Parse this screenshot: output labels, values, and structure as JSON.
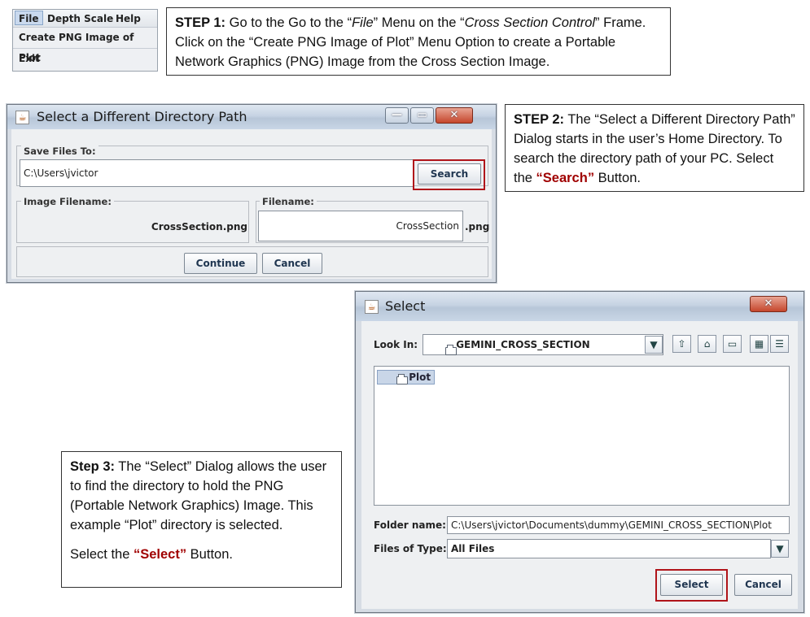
{
  "step1": {
    "menubar": [
      "File",
      "Depth Scale",
      "Help"
    ],
    "menu_items": [
      "Create PNG Image of Plot",
      "Exit"
    ],
    "callout_label": "STEP 1:",
    "callout_pre": " Go to the Go to the “",
    "callout_file": "File",
    "callout_mid": "” Menu on the “",
    "callout_frame": "Cross Section Control",
    "callout_post": "” Frame.  Click on the “Create PNG Image of Plot” Menu Option to create a Portable Network Graphics (PNG) Image from the Cross Section Image."
  },
  "dir_dialog": {
    "title": "Select a Different Directory Path",
    "save_label": "Save Files To:",
    "path_value": "C:\\Users\\jvictor",
    "search_button": "Search",
    "image_filename_label": "Image Filename:",
    "image_filename_value": "CrossSection.png",
    "filename_label": "Filename:",
    "filename_value": "CrossSection",
    "extension": ".png",
    "continue_button": "Continue",
    "cancel_button": "Cancel"
  },
  "step2": {
    "label": "STEP 2:",
    "text_pre": " The “Select a Different Directory Path” Dialog starts in the user’s Home Directory. To search the directory path of your PC. Select the ",
    "highlight": "“Search”",
    "text_post": "  Button."
  },
  "select_dialog": {
    "title": "Select",
    "look_in_label": "Look In:",
    "look_in_value": "GEMINI_CROSS_SECTION",
    "list_items": [
      "Plot"
    ],
    "folder_name_label": "Folder name:",
    "folder_name_value": "C:\\Users\\jvictor\\Documents\\dummy\\GEMINI_CROSS_SECTION\\Plot",
    "files_type_label": "Files of Type:",
    "files_type_value": "All Files",
    "select_button": "Select",
    "cancel_button": "Cancel"
  },
  "step3": {
    "label": "Step 3:",
    "text": " The “Select” Dialog allows the user to find the directory to hold the PNG (Portable Network Graphics) Image.  This example “Plot” directory is selected.",
    "select_pre": "Select the ",
    "select_highlight": "“Select”",
    "select_post": " Button."
  },
  "colors": {
    "highlight_red": "#a00000",
    "red_box": "#b0141a"
  }
}
